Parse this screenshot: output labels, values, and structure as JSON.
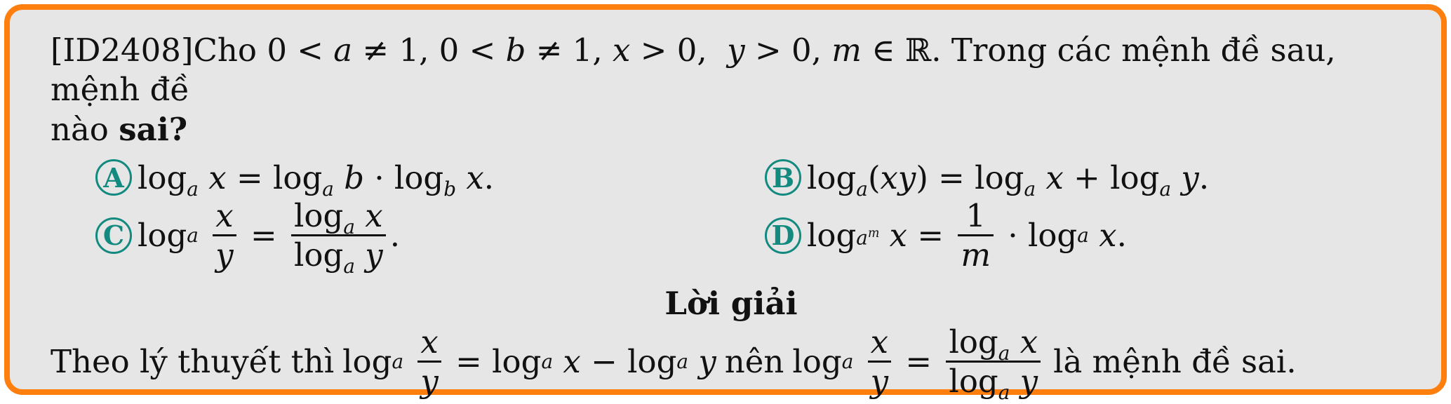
{
  "question": {
    "id": "[ID2408]",
    "lead": "Cho",
    "tail": ". Trong các mệnh đề sau, mệnh đề",
    "line2": "nào",
    "emphasis": "sai?"
  },
  "options": [
    {
      "label": "A"
    },
    {
      "label": "B"
    },
    {
      "label": "C"
    },
    {
      "label": "D"
    }
  ],
  "solution": {
    "title": "Lời giải",
    "lead": "Theo lý thuyết thì",
    "middle": "nên",
    "tail": "là mệnh đề sai."
  },
  "colors": {
    "border": "#ff7f0e",
    "background": "#e6e6e6",
    "badge": "#138a7f"
  }
}
